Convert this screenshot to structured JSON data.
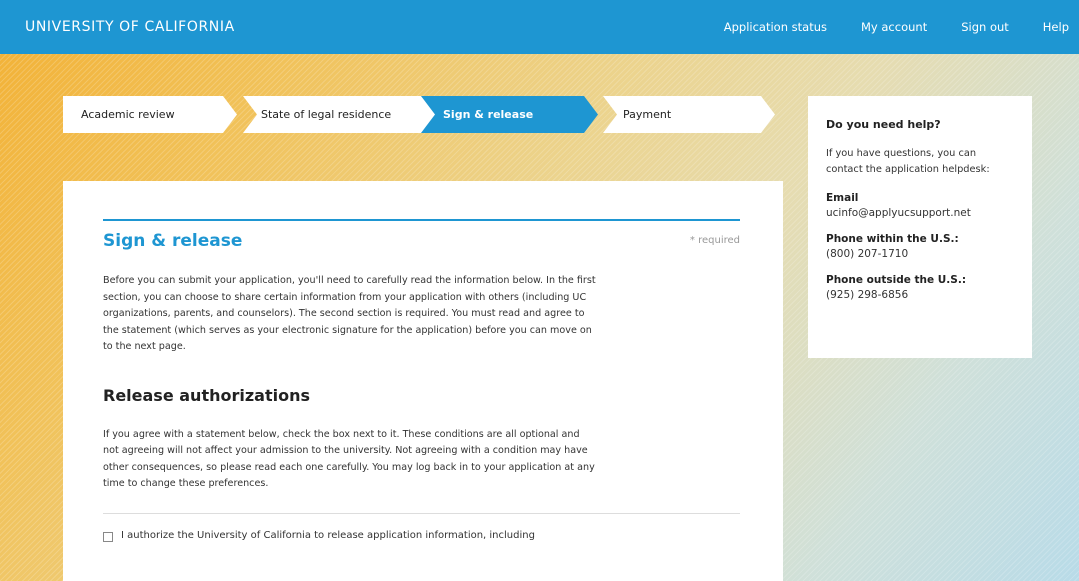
{
  "header": {
    "brand": "UNIVERSITY OF CALIFORNIA",
    "nav": [
      "Application status",
      "My account",
      "Sign out",
      "Help"
    ]
  },
  "steps": [
    {
      "label": "Academic review",
      "active": false
    },
    {
      "label": "State of legal residence",
      "active": false
    },
    {
      "label": "Sign & release",
      "active": true
    },
    {
      "label": "Payment",
      "active": false
    }
  ],
  "main": {
    "title": "Sign & release",
    "required_note": "* required",
    "intro": "Before you can submit your application, you'll need to carefully read the information below. In the first section, you can choose to share certain information from your application with others (including UC organizations, parents, and counselors). The second section is required. You must read and agree to the statement (which serves as your electronic signature for the application) before you can move on to the next page.",
    "section_title": "Release authorizations",
    "section_intro": "If you agree with a statement below, check the box next to it. These conditions are all optional and not agreeing will not affect your admission to the university. Not agreeing with a condition may have other consequences, so please read each one carefully. You may log back in to your application at any time to change these preferences.",
    "first_authorization": "I authorize the University of California to release application information, including"
  },
  "help": {
    "title": "Do you need help?",
    "intro": "If you have questions, you can contact the application helpdesk:",
    "email_label": "Email",
    "email": "ucinfo@applyucsupport.net",
    "phone_us_label": "Phone within the U.S.:",
    "phone_us": "(800) 207-1710",
    "phone_intl_label": "Phone outside the U.S.:",
    "phone_intl": "(925) 298-6856"
  },
  "colors": {
    "brand_blue": "#1e96d2",
    "gradient_orange": "#f2b135",
    "gradient_blue": "#b8dbe8"
  }
}
